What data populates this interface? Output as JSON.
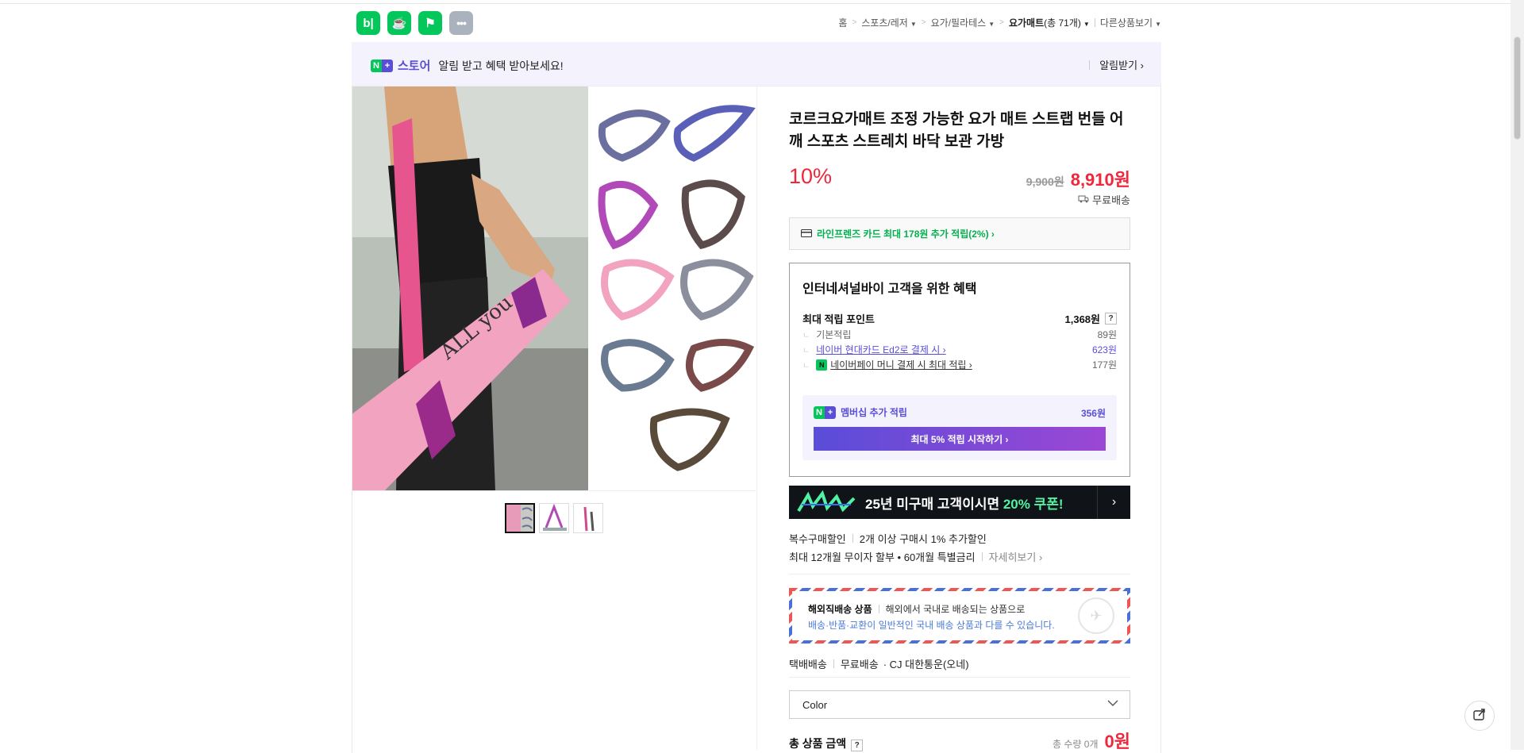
{
  "app_icons": [
    {
      "name": "blog-icon",
      "glyph": "b|"
    },
    {
      "name": "cafe-icon",
      "glyph": "☕"
    },
    {
      "name": "bookmark-icon",
      "glyph": "⚑"
    },
    {
      "name": "more-icon",
      "glyph": "•••"
    }
  ],
  "breadcrumb": {
    "home": "홈",
    "level1": "스포츠/레저",
    "level2": "요가/필라테스",
    "current": "요가매트",
    "count": "(총 71개)",
    "other": "다른상품보기"
  },
  "store_bar": {
    "logo_n": "N",
    "logo_plus": "+",
    "store_name": "스토어",
    "message": "알림 받고 혜택 받아보세요!",
    "notify_label": "알림받기 ›"
  },
  "product": {
    "title": "코르크요가매트 조정 가능한 요가 매트 스트랩 번들 어깨 스포츠 스트레치 바닥 보관 가방",
    "discount": "10%",
    "original_price": "9,900원",
    "sale_price": "8,910원",
    "shipping": "무료배송"
  },
  "card_promo": "라인프렌즈 카드 최대 178원 추가 적립(2%) ›",
  "benefit": {
    "heading": "인터네셔널바이 고객을 위한 혜택",
    "max_label": "최대 적립 포인트",
    "max_value": "1,368원",
    "rows": [
      {
        "label": "기본적립",
        "value": "89원"
      },
      {
        "label": "네이버 현대카드 Ed2로 결제 시 ›",
        "value": "623원"
      },
      {
        "label": "네이버페이 머니 결제 시 최대 적립 ›",
        "value": "177원"
      }
    ],
    "member_label": "멤버십 추가 적립",
    "member_value": "356원",
    "member_button": "최대 5% 적립 시작하기 ›"
  },
  "banner": {
    "text_main": "25년 미구매 고객이시면 ",
    "text_highlight": "20% 쿠폰!"
  },
  "multi_discount": {
    "label": "복수구매할인",
    "text": "2개 이상 구매시 1% 추가할인"
  },
  "installment": {
    "text": "최대 12개월 무이자 할부 • 60개월 특별금리",
    "more": "자세히보기 ›"
  },
  "overseas": {
    "title": "해외직배송 상품",
    "desc": "해외에서 국내로 배송되는 상품으로",
    "note": "배송·반품·교환이 일반적인 국내 배송 상품과 다를 수 있습니다."
  },
  "delivery": {
    "type": "택배배송",
    "fee": "무료배송",
    "carrier": "· CJ 대한통운(오네)"
  },
  "option_select": {
    "label": "Color"
  },
  "total": {
    "label": "총 상품 금액",
    "qty": "총 수량 0개",
    "amount": "0원"
  },
  "colors": {
    "accent": "#f0273b",
    "naver_green": "#03c75a",
    "purple": "#5a4dd8"
  }
}
